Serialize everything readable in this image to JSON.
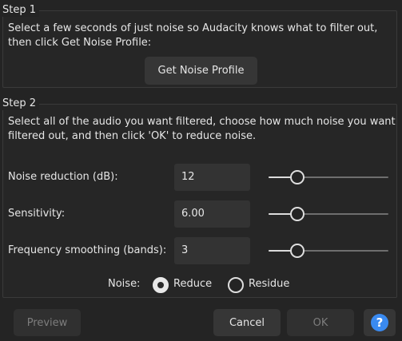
{
  "step1": {
    "title": "Step 1",
    "description": "Select a few seconds of just noise so Audacity knows what to filter out, then click Get Noise Profile:",
    "get_profile_label": "Get Noise Profile"
  },
  "step2": {
    "title": "Step 2",
    "description": "Select all of the audio you want filtered, choose how much noise you want filtered out, and then click 'OK' to reduce noise.",
    "params": [
      {
        "label": "Noise reduction (dB):",
        "value": "12",
        "slider_fraction": 0.24
      },
      {
        "label": "Sensitivity:",
        "value": "6.00",
        "slider_fraction": 0.24
      },
      {
        "label": "Frequency smoothing (bands):",
        "value": "3",
        "slider_fraction": 0.24
      }
    ],
    "noise": {
      "label": "Noise:",
      "options": [
        {
          "label": "Reduce",
          "checked": true
        },
        {
          "label": "Residue",
          "checked": false
        }
      ]
    }
  },
  "footer": {
    "preview_label": "Preview",
    "cancel_label": "Cancel",
    "ok_label": "OK",
    "help_glyph": "?"
  },
  "colors": {
    "accent": "#3a8af0",
    "background": "#242424"
  }
}
